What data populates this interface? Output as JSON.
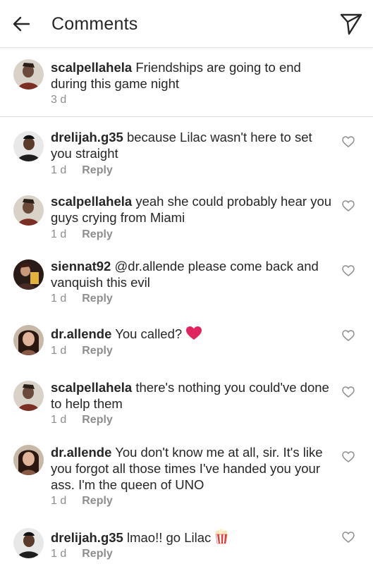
{
  "header": {
    "title": "Comments",
    "back_icon": "back-arrow-icon",
    "send_icon": "paper-plane-icon"
  },
  "caption": {
    "username": "scalpellahela",
    "text": "Friendships are going to end during this game night",
    "time": "3 d"
  },
  "reply_label": "Reply",
  "comments": [
    {
      "username": "drelijah.g35",
      "text": "because Lilac wasn't here to set you straight",
      "time": "1 d"
    },
    {
      "username": "scalpellahela",
      "text": "yeah she could probably hear you guys crying from Miami",
      "time": "1 d"
    },
    {
      "username": "siennat92",
      "text": "@dr.allende please come back and vanquish this evil",
      "time": "1 d"
    },
    {
      "username": "dr.allende",
      "text": "You called?",
      "time": "1 d",
      "emoji": "red-heart-emoji"
    },
    {
      "username": "scalpellahela",
      "text": "there's nothing you could've done to help them",
      "time": "1 d"
    },
    {
      "username": "dr.allende",
      "text": "You don't know me at all, sir. It's like you forgot all those times I've handed you your ass. I'm the queen of UNO",
      "time": "1 d"
    },
    {
      "username": "drelijah.g35",
      "text": "lmao!! go Lilac",
      "time": "1 d",
      "emoji": "popcorn-emoji"
    }
  ],
  "colors": {
    "text": "#262626",
    "secondary": "#8e8e8e",
    "divider": "#dbdbdb",
    "heart_emoji": "#e0245e"
  }
}
